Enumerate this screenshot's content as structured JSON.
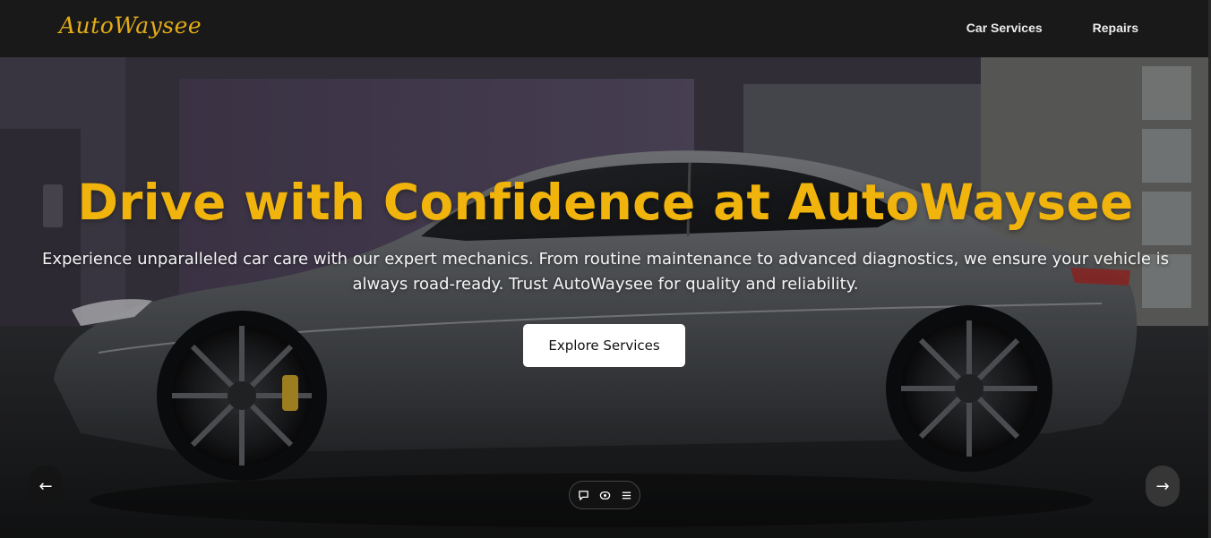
{
  "brand": {
    "logo_text": "AutoWaysee",
    "accent_color": "#e4ac16"
  },
  "nav": {
    "links": [
      {
        "label": "Car Services"
      },
      {
        "label": "Repairs"
      }
    ]
  },
  "hero": {
    "title": "Drive with Confidence at AutoWaysee",
    "subtitle": "Experience unparalleled car care with our expert mechanics. From routine maintenance to advanced diagnostics, we ensure your vehicle is always road-ready. Trust AutoWaysee for quality and reliability.",
    "cta_label": "Explore Services",
    "title_color": "#f0b40c",
    "background_image": "car-in-garage"
  },
  "carousel": {
    "prev_label": "←",
    "next_label": "→"
  },
  "widget": {
    "icons": [
      "chat-icon",
      "eye-icon",
      "menu-icon"
    ]
  }
}
